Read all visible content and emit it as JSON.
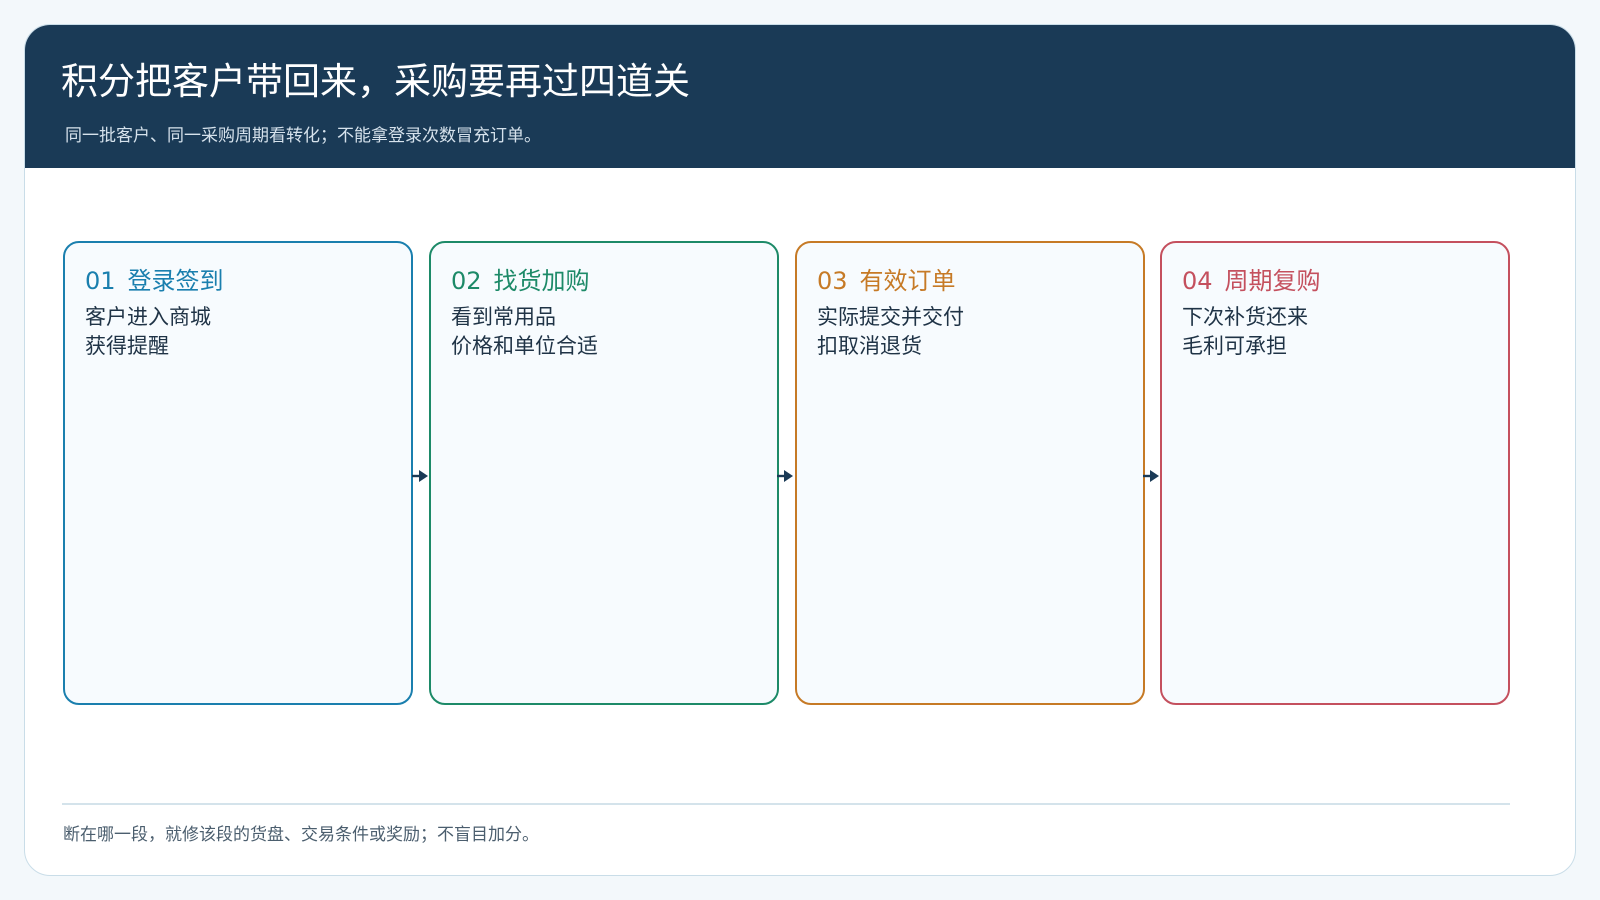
{
  "header": {
    "title": "积分把客户带回来，采购要再过四道关",
    "subtitle": "同一批客户、同一采购周期看转化；不能拿登录次数冒充订单。"
  },
  "stages": [
    {
      "num": "01",
      "title": "登录签到",
      "lines": [
        "客户进入商城",
        "获得提醒"
      ],
      "color": "#1a7fae"
    },
    {
      "num": "02",
      "title": "找货加购",
      "lines": [
        "看到常用品",
        "价格和单位合适"
      ],
      "color": "#1d8a68"
    },
    {
      "num": "03",
      "title": "有效订单",
      "lines": [
        "实际提交并交付",
        "扣取消退货"
      ],
      "color": "#c67a26"
    },
    {
      "num": "04",
      "title": "周期复购",
      "lines": [
        "下次补货还来",
        "毛利可承担"
      ],
      "color": "#c4505e"
    }
  ],
  "footer": {
    "note": "断在哪一段，就修该段的货盘、交易条件或奖励；不盲目加分。"
  },
  "icons": {
    "connector": "arrow-right-icon"
  }
}
